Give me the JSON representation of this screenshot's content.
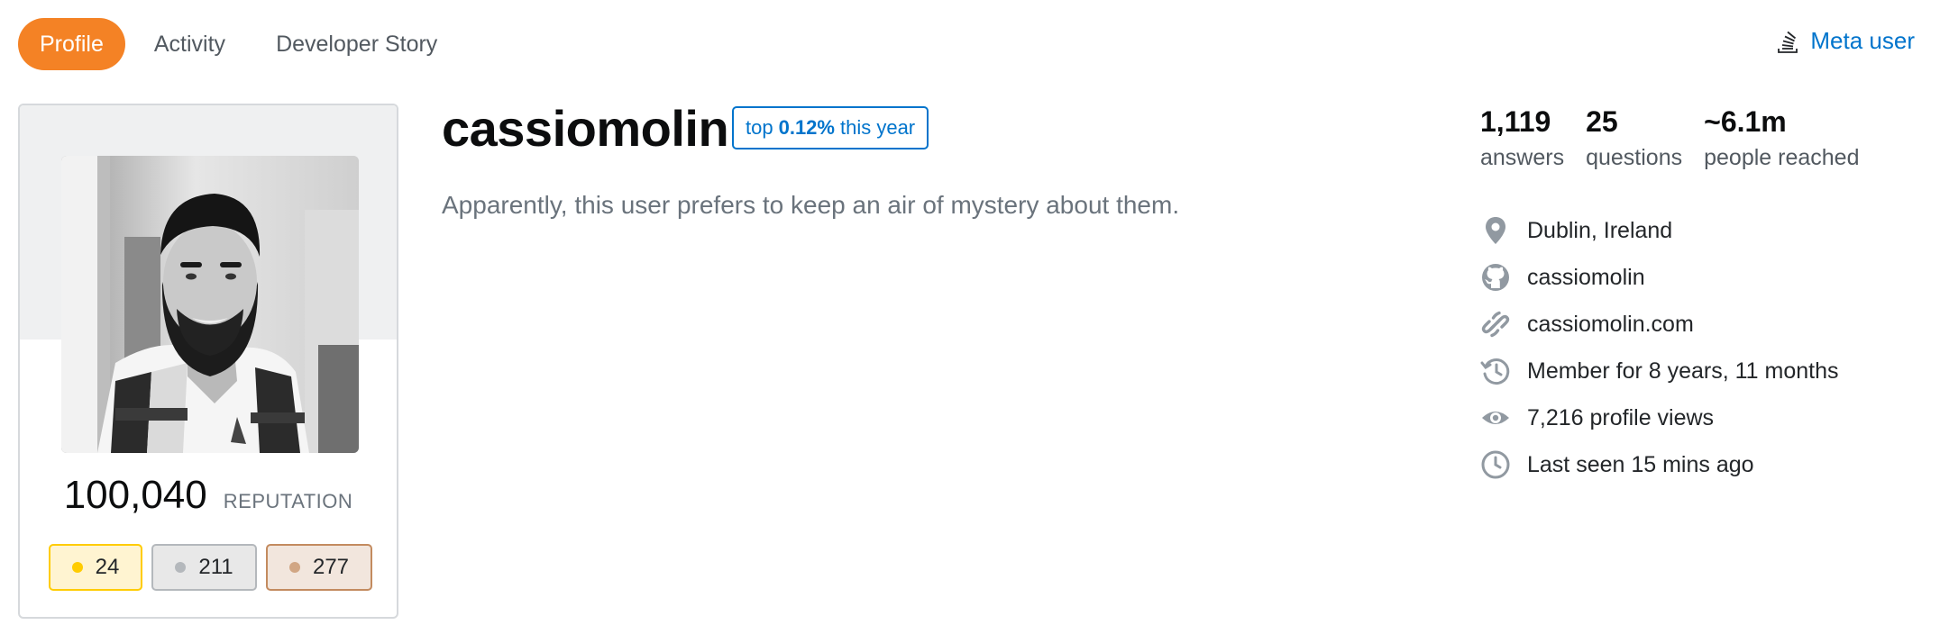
{
  "nav": {
    "tabs": [
      {
        "label": "Profile",
        "active": true
      },
      {
        "label": "Activity",
        "active": false
      },
      {
        "label": "Developer Story",
        "active": false
      }
    ],
    "meta_link": "Meta user",
    "meta_icon": "stackexchange-stack-icon"
  },
  "profile": {
    "username": "cassiomolin",
    "rank": {
      "prefix": "top",
      "value": "0.12%",
      "suffix": "this year"
    },
    "about": "Apparently, this user prefers to keep an air of mystery about them.",
    "reputation": {
      "value": "100,040",
      "label": "REPUTATION"
    },
    "badges": {
      "gold": "24",
      "silver": "211",
      "bronze": "277"
    }
  },
  "stats": [
    {
      "value": "1,119",
      "label": "answers"
    },
    {
      "value": "25",
      "label": "questions"
    },
    {
      "value": "~6.1m",
      "label": "people reached"
    }
  ],
  "details": [
    {
      "icon": "location-pin-icon",
      "text": "Dublin, Ireland"
    },
    {
      "icon": "github-icon",
      "text": "cassiomolin"
    },
    {
      "icon": "link-icon",
      "text": "cassiomolin.com"
    },
    {
      "icon": "history-icon",
      "text": "Member for 8 years, 11 months"
    },
    {
      "icon": "eye-icon",
      "text": "7,216 profile views"
    },
    {
      "icon": "clock-icon",
      "text": "Last seen 15 mins ago"
    }
  ],
  "colors": {
    "accent": "#f48225",
    "link": "#0074cc",
    "gold": "#ffcc01",
    "silver": "#b4b8bc",
    "bronze": "#d1a684",
    "icon": "#9199a1"
  }
}
